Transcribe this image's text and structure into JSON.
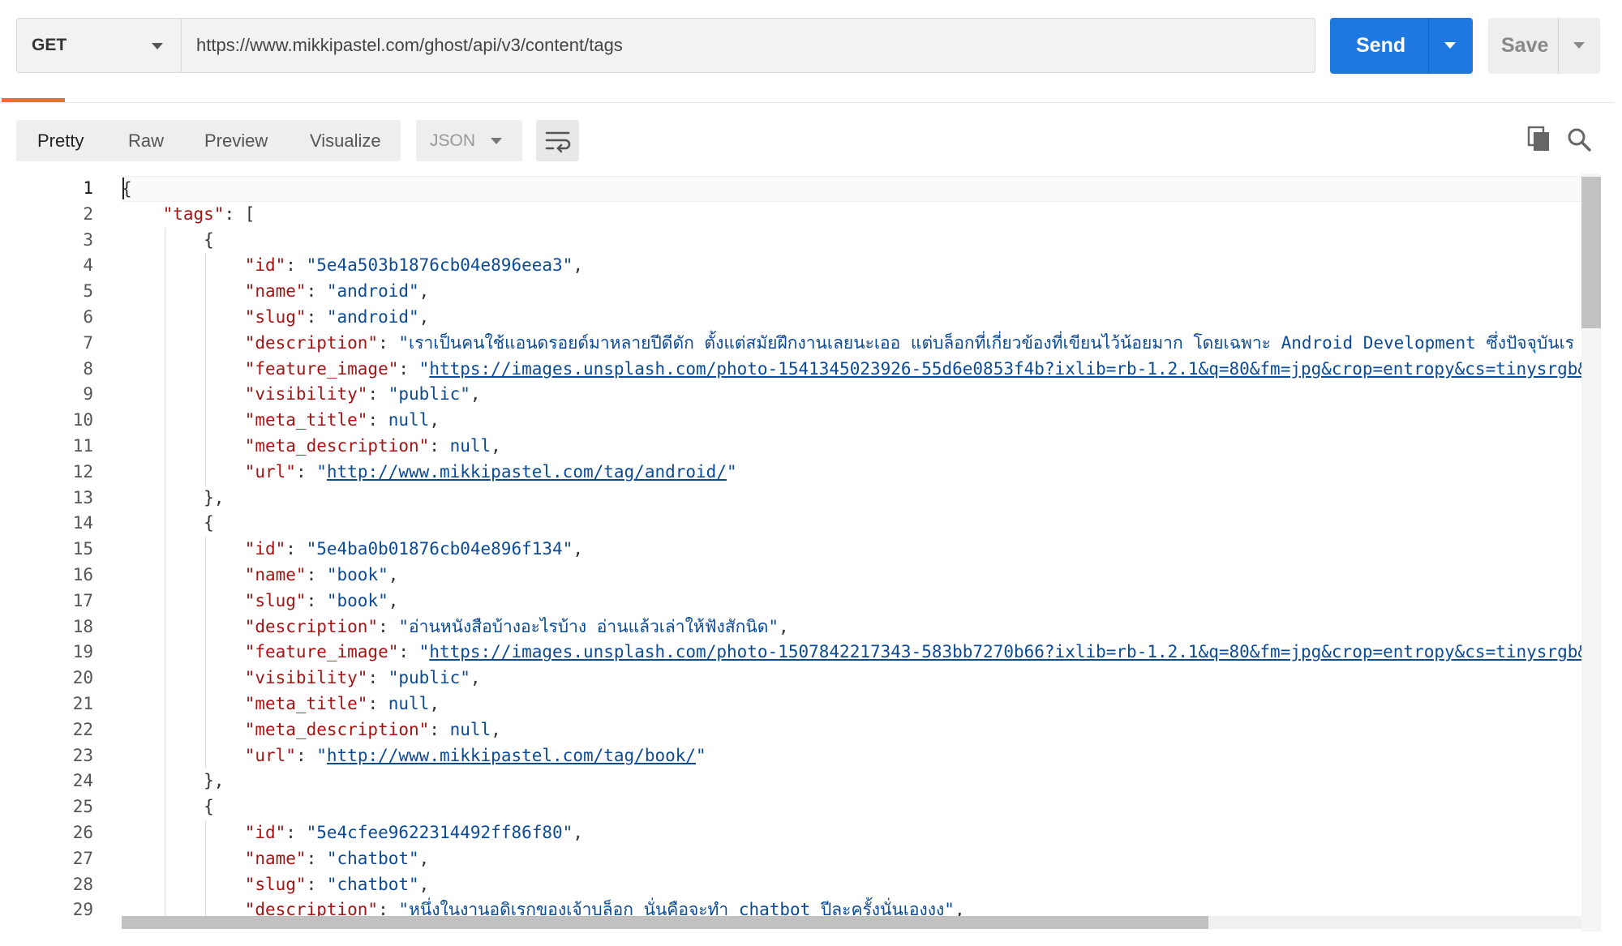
{
  "request": {
    "method": "GET",
    "url": "https://www.mikkipastel.com/ghost/api/v3/content/tags",
    "send_label": "Send",
    "save_label": "Save"
  },
  "response_toolbar": {
    "tabs": [
      {
        "label": "Pretty",
        "active": true
      },
      {
        "label": "Raw",
        "active": false
      },
      {
        "label": "Preview",
        "active": false
      },
      {
        "label": "Visualize",
        "active": false
      }
    ],
    "format": "JSON",
    "icons": [
      "wrap-lines-icon",
      "copy-icon",
      "search-icon"
    ]
  },
  "editor": {
    "lines": [
      "{",
      "    \"tags\": [",
      "        {",
      "            \"id\": \"5e4a503b1876cb04e896eea3\",",
      "            \"name\": \"android\",",
      "            \"slug\": \"android\",",
      "            \"description\": \"เราเป็นคนใช้แอนดรอยด์มาหลายปีดีดัก ตั้งแต่สมัยฝึกงานเลยนะเออ แต่บล็อกที่เกี่ยวข้องที่เขียนไว้น้อยมาก โดยเฉพาะ Android Development ซึ่งปัจจุบันเร",
      "            \"feature_image\": \"https://images.unsplash.com/photo-1541345023926-55d6e0853f4b?ixlib=rb-1.2.1&q=80&fm=jpg&crop=entropy&cs=tinysrgb&",
      "            \"visibility\": \"public\",",
      "            \"meta_title\": null,",
      "            \"meta_description\": null,",
      "            \"url\": \"http://www.mikkipastel.com/tag/android/\"",
      "        },",
      "        {",
      "            \"id\": \"5e4ba0b01876cb04e896f134\",",
      "            \"name\": \"book\",",
      "            \"slug\": \"book\",",
      "            \"description\": \"อ่านหนังสือบ้างอะไรบ้าง อ่านแล้วเล่าให้ฟังสักนิด\",",
      "            \"feature_image\": \"https://images.unsplash.com/photo-1507842217343-583bb7270b66?ixlib=rb-1.2.1&q=80&fm=jpg&crop=entropy&cs=tinysrgb&",
      "            \"visibility\": \"public\",",
      "            \"meta_title\": null,",
      "            \"meta_description\": null,",
      "            \"url\": \"http://www.mikkipastel.com/tag/book/\"",
      "        },",
      "        {",
      "            \"id\": \"5e4cfee9622314492ff86f80\",",
      "            \"name\": \"chatbot\",",
      "            \"slug\": \"chatbot\",",
      "            \"description\": \"หนึ่งในงานอดิเรกของเจ้าบล็อก นั่นคือจะทำ chatbot ปีละครั้งนั่นเองงง\","
    ]
  }
}
